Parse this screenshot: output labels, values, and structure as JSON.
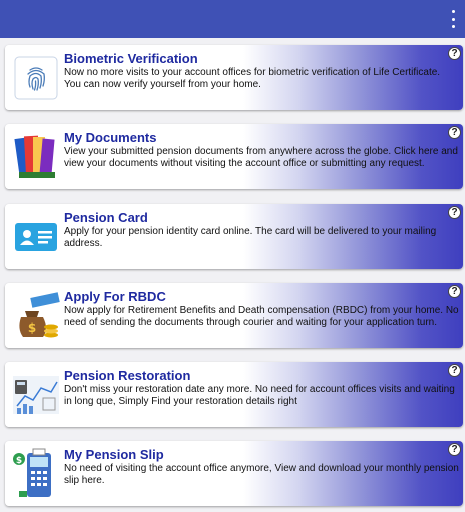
{
  "appbar": {
    "menu_icon": "more-vert-icon"
  },
  "services": [
    {
      "id": "biometric",
      "title": "Biometric Verification",
      "description": "Now no more visits to your account offices for biometric verification of Life Certificate. You can now verify yourself from your home.",
      "icon": "fingerprint-icon",
      "help": "?"
    },
    {
      "id": "documents",
      "title": "My Documents",
      "description": "View your submitted pension documents from anywhere across the globe. Click here and view your documents without visiting the account office or submitting any request.",
      "icon": "documents-folders-icon",
      "help": "?"
    },
    {
      "id": "pension-card",
      "title": "Pension Card",
      "description": "Apply for your pension identity card online. The card will be delivered to your mailing address.",
      "icon": "id-card-icon",
      "help": "?"
    },
    {
      "id": "rbdc",
      "title": "Apply For RBDC",
      "description": "Now apply for Retirement Benefits and Death compensation (RBDC) from your home. No need of sending the documents through courier and waiting for your application turn.",
      "icon": "money-bag-icon",
      "help": "?"
    },
    {
      "id": "restoration",
      "title": "Pension Restoration",
      "description": "Don't miss your restoration date any more. No need for account offices visits and waiting in long que, Simply Find your restoration details right",
      "icon": "charts-calculator-icon",
      "help": "?"
    },
    {
      "id": "pension-slip",
      "title": "My Pension Slip",
      "description": "No need of visiting the account office anymore, View and download your monthly pension slip here.",
      "icon": "payment-terminal-icon",
      "help": "?"
    }
  ]
}
